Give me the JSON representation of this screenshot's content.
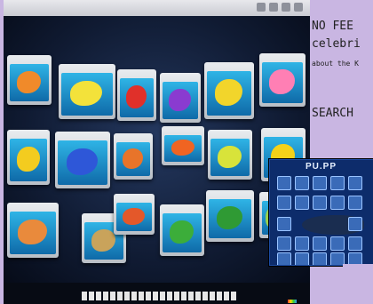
{
  "overlay": {
    "line1": "NO FEE",
    "line2": "celebri",
    "line3": "about the K",
    "search": "SEARCH"
  },
  "popup": {
    "title": "PU.PP"
  },
  "colors": {
    "page_bg": "#c9b6e2",
    "stage_bg": "#101b33",
    "popup_bg": "#0d2c6b"
  }
}
